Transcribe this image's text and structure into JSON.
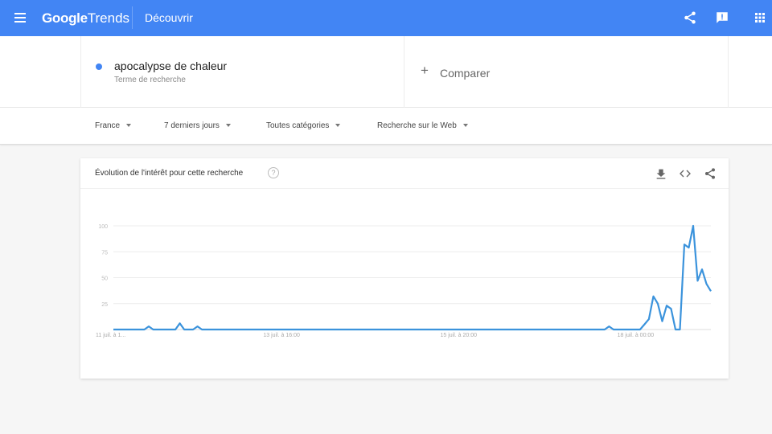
{
  "topbar": {
    "logo_google": "Google",
    "logo_trends": "Trends",
    "nav_label": "Découvrir",
    "icons": [
      "menu-icon",
      "share-icon",
      "feedback-icon",
      "apps-icon"
    ]
  },
  "search": {
    "term": "apocalypse de chaleur",
    "term_type": "Terme de recherche",
    "term_color": "#4285f4",
    "compare_plus": "+",
    "compare_label": "Comparer"
  },
  "filters": {
    "region": "France",
    "period": "7 derniers jours",
    "category": "Toutes catégories",
    "search_type": "Recherche sur le Web"
  },
  "card": {
    "title": "Évolution de l'intérêt pour cette recherche",
    "help": "?",
    "icons": [
      "download-icon",
      "embed-icon",
      "share-icon"
    ]
  },
  "chart_data": {
    "type": "line",
    "title": "Évolution de l'intérêt pour cette recherche",
    "xlabel": "",
    "ylabel": "",
    "ylim": [
      0,
      100
    ],
    "yticks": [
      25,
      50,
      75,
      100
    ],
    "grid": true,
    "xtick_labels": [
      {
        "label": "11 juil. à 1...",
        "index": 0
      },
      {
        "label": "13 juil. à 16:00",
        "index": 38
      },
      {
        "label": "15 juil. à 20:00",
        "index": 78
      },
      {
        "label": "18 juil. à 00:00",
        "index": 118
      }
    ],
    "series": [
      {
        "name": "apocalypse de chaleur",
        "color": "#3b93dc",
        "values": [
          0,
          0,
          0,
          0,
          0,
          0,
          0,
          0,
          3,
          0,
          0,
          0,
          0,
          0,
          0,
          6,
          0,
          0,
          0,
          3,
          0,
          0,
          0,
          0,
          0,
          0,
          0,
          0,
          0,
          0,
          0,
          0,
          0,
          0,
          0,
          0,
          0,
          0,
          0,
          0,
          0,
          0,
          0,
          0,
          0,
          0,
          0,
          0,
          0,
          0,
          0,
          0,
          0,
          0,
          0,
          0,
          0,
          0,
          0,
          0,
          0,
          0,
          0,
          0,
          0,
          0,
          0,
          0,
          0,
          0,
          0,
          0,
          0,
          0,
          0,
          0,
          0,
          0,
          0,
          0,
          0,
          0,
          0,
          0,
          0,
          0,
          0,
          0,
          0,
          0,
          0,
          0,
          0,
          0,
          0,
          0,
          0,
          0,
          0,
          0,
          0,
          0,
          0,
          0,
          0,
          0,
          0,
          0,
          0,
          0,
          0,
          0,
          3,
          0,
          0,
          0,
          0,
          0,
          0,
          0,
          5,
          10,
          32,
          25,
          8,
          23,
          20,
          0,
          0,
          82,
          79,
          100,
          47,
          58,
          44,
          37
        ]
      }
    ]
  }
}
